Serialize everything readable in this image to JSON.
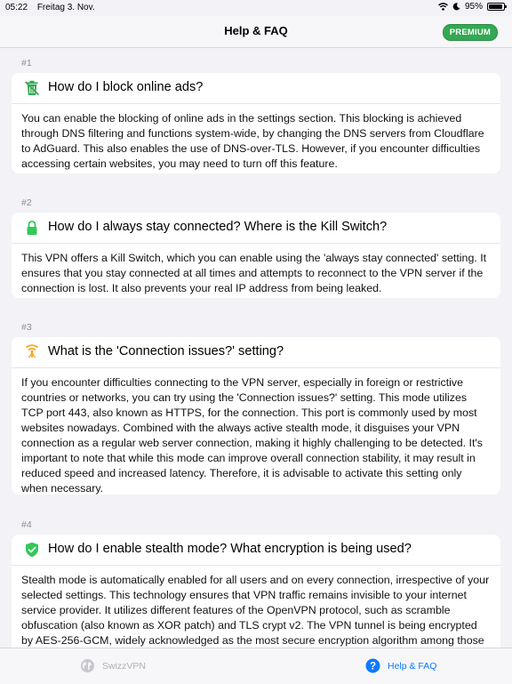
{
  "status_bar": {
    "time": "05:22",
    "date": "Freitag 3. Nov.",
    "battery_percent": "95%",
    "battery_level": 0.95
  },
  "nav": {
    "title": "Help & FAQ",
    "premium_badge": "PREMIUM"
  },
  "faq": [
    {
      "number": "#1",
      "icon": "trash-icon",
      "question": "How do I block online ads?",
      "answer": "You can enable the blocking of online ads in the settings section. This blocking is achieved through DNS filtering and functions system-wide, by changing the DNS servers from Cloudflare to AdGuard. This also enables the use of DNS-over-TLS. However, if you encounter difficulties accessing certain websites, you may need to turn off this feature."
    },
    {
      "number": "#2",
      "icon": "lock-icon",
      "question": "How do I always stay connected? Where is the Kill Switch?",
      "answer": "This VPN offers a Kill Switch, which you can enable using the 'always stay connected' setting. It ensures that you stay connected at all times and attempts to reconnect to the VPN server if the connection is lost. It also prevents your real IP address from being leaked."
    },
    {
      "number": "#3",
      "icon": "antenna-icon",
      "question": "What is the 'Connection issues?' setting?",
      "answer": "If you encounter difficulties connecting to the VPN server, especially in foreign or restrictive countries or networks, you can try using the 'Connection issues?' setting. This mode utilizes TCP port 443, also known as HTTPS, for the connection. This port is commonly used by most websites nowadays. Combined with the always active stealth mode, it disguises your VPN connection as a regular web server connection, making it highly challenging to be detected. It's important to note that while this mode can improve overall connection stability, it may result in reduced speed and increased latency. Therefore, it is advisable to activate this setting only when necessary."
    },
    {
      "number": "#4",
      "icon": "shield-check-icon",
      "question": "How do I enable stealth mode? What encryption is being used?",
      "answer": "Stealth mode is automatically enabled for all users and on every connection, irrespective of your selected settings. This technology ensures that VPN traffic remains invisible to your internet service provider. It utilizes different features of the OpenVPN protocol, such as scramble obfuscation (also known as XOR patch) and TLS crypt v2. The VPN tunnel is being encrypted by AES-256-GCM, widely acknowledged as the most secure encryption algorithm among those available."
    }
  ],
  "tabs": [
    {
      "label": "SwizzVPN",
      "icon": "globe-icon",
      "active": false
    },
    {
      "label": "Help & FAQ",
      "icon": "question-circle-icon",
      "active": true
    }
  ],
  "colors": {
    "accent": "#0a7aff",
    "premium": "#34a853",
    "lock": "#34c759",
    "antenna": "#f5a623",
    "background": "#f2f2f7"
  }
}
